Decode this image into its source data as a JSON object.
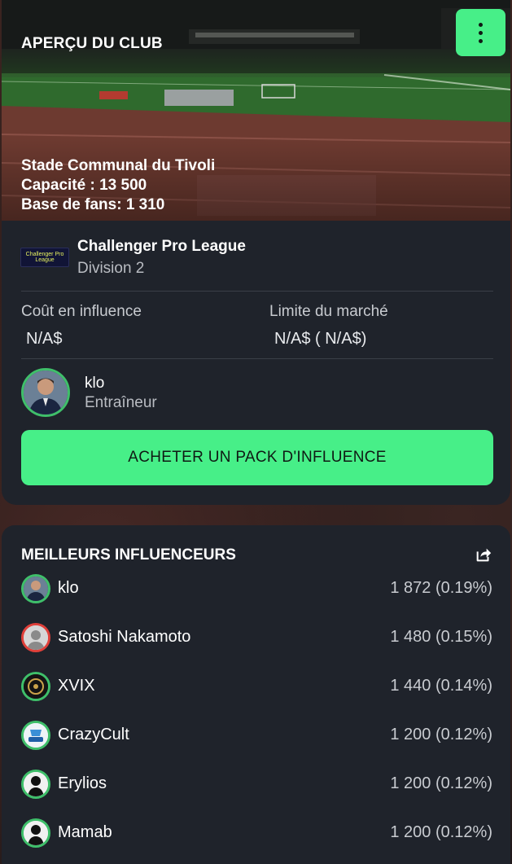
{
  "club": {
    "header_title": "APERÇU DU CLUB",
    "stadium": {
      "name": "Stade Communal du Tivoli",
      "capacity": "Capacité : 13 500",
      "fan_base": "Base de fans: 1 310"
    },
    "league": {
      "logo_text": "Challenger Pro League",
      "name": "Challenger Pro League",
      "division": "Division 2"
    },
    "stats": {
      "influence_cost_label": "Coût en influence",
      "influence_cost_value": "N/A$",
      "market_limit_label": "Limite du marché",
      "market_limit_value": "N/A$ ( N/A$)"
    },
    "coach": {
      "name": "klo",
      "role": "Entraîneur"
    },
    "buy_button_label": "ACHETER UN PACK D'INFLUENCE"
  },
  "influencers": {
    "title": "MEILLEURS INFLUENCEURS",
    "rows": [
      {
        "name": "klo",
        "score": "1 872 (0.19%)",
        "avatar": "coach-photo"
      },
      {
        "name": "Satoshi Nakamoto",
        "score": "1 480 (0.15%)",
        "avatar": "default-user-red"
      },
      {
        "name": "XVIX",
        "score": "1 440 (0.14%)",
        "avatar": "dark-emblem"
      },
      {
        "name": "CrazyCult",
        "score": "1 200 (0.12%)",
        "avatar": "blue-logo"
      },
      {
        "name": "Erylios",
        "score": "1 200 (0.12%)",
        "avatar": "default-user"
      },
      {
        "name": "Mamab",
        "score": "1 200 (0.12%)",
        "avatar": "default-user"
      }
    ]
  },
  "colors": {
    "accent": "#47ef88",
    "card_bg": "#1f232b",
    "avatar_ring": "#3fbf6a",
    "avatar_ring_alert": "#e0403a"
  }
}
